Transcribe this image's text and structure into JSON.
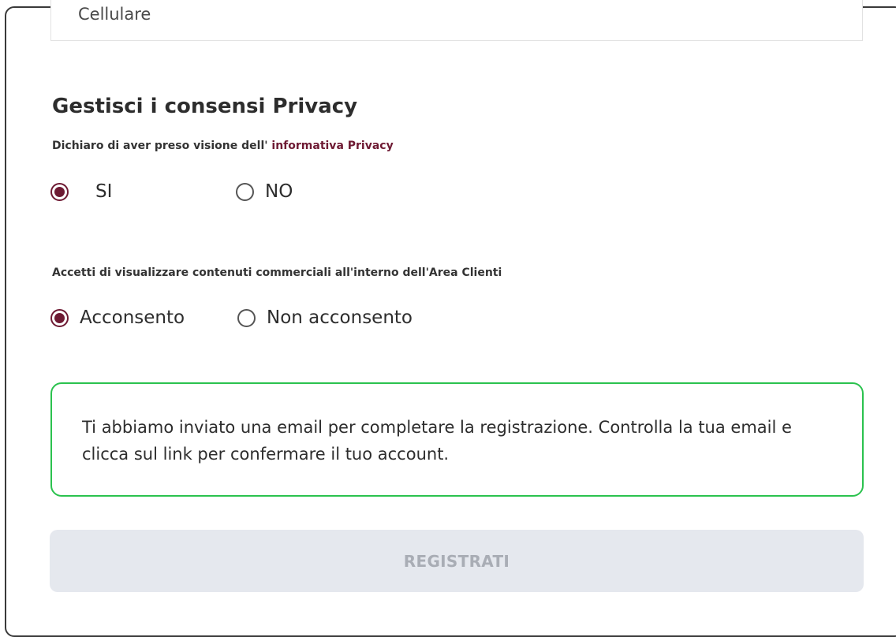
{
  "contact": {
    "phone_placeholder": "Cellulare"
  },
  "privacy": {
    "title": "Gestisci i consensi Privacy",
    "question_prefix": "Dichiaro di aver preso visione dell'",
    "question_link": "informativa Privacy",
    "options": [
      {
        "label": "SI",
        "selected": true
      },
      {
        "label": "NO",
        "selected": false
      }
    ]
  },
  "commercial": {
    "question": "Accetti di visualizzare contenuti commerciali all'interno dell'Area Clienti",
    "options": [
      {
        "label": "Acconsento",
        "selected": true
      },
      {
        "label": "Non acconsento",
        "selected": false
      }
    ]
  },
  "notice": {
    "message": "Ti abbiamo inviato una email per completare la registrazione. Controlla la tua email e clicca sul link per confermare il tuo account."
  },
  "submit": {
    "label": "REGISTRATI",
    "disabled": true
  },
  "colors": {
    "accent": "#6e1a33",
    "success_border": "#2bc24e",
    "disabled_bg": "#e5e8ee",
    "disabled_text": "#a9adb5"
  }
}
